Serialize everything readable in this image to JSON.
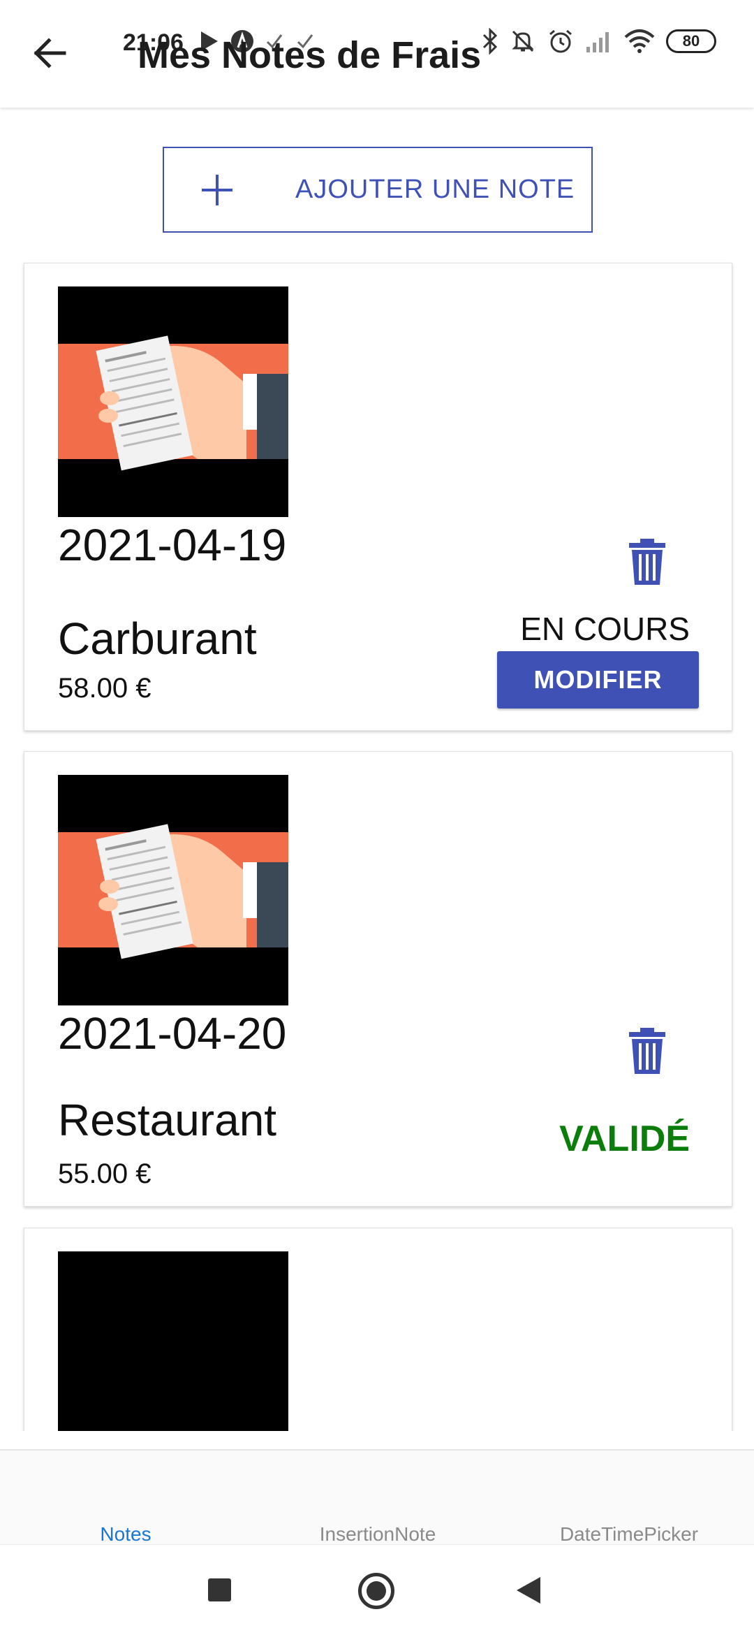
{
  "status_bar": {
    "time": "21:06",
    "battery": "80",
    "left_icons": [
      "play-icon",
      "a-circle-icon",
      "check-icon",
      "check-icon"
    ],
    "right_icons": [
      "bluetooth-icon",
      "mute-icon",
      "alarm-icon",
      "signal-icon",
      "wifi-icon"
    ]
  },
  "header": {
    "title": "Mes Notes de Frais"
  },
  "add_button": {
    "label": "AJOUTER UNE NOTE"
  },
  "notes": [
    {
      "date": "2021-04-19",
      "category": "Carburant",
      "amount": "58.00 €",
      "status": "EN COURS",
      "action_label": "MODIFIER"
    },
    {
      "date": "2021-04-20",
      "category": "Restaurant",
      "amount": "55.00 €",
      "status": "VALIDÉ"
    }
  ],
  "tabs": [
    {
      "label": "Notes",
      "active": true
    },
    {
      "label": "InsertionNote",
      "active": false
    },
    {
      "label": "DateTimePicker",
      "active": false
    }
  ],
  "colors": {
    "primary": "#3f51b5",
    "active_tab": "#1976d2",
    "validated": "#0a7d0a",
    "receipt_bg": "#f26d49"
  }
}
